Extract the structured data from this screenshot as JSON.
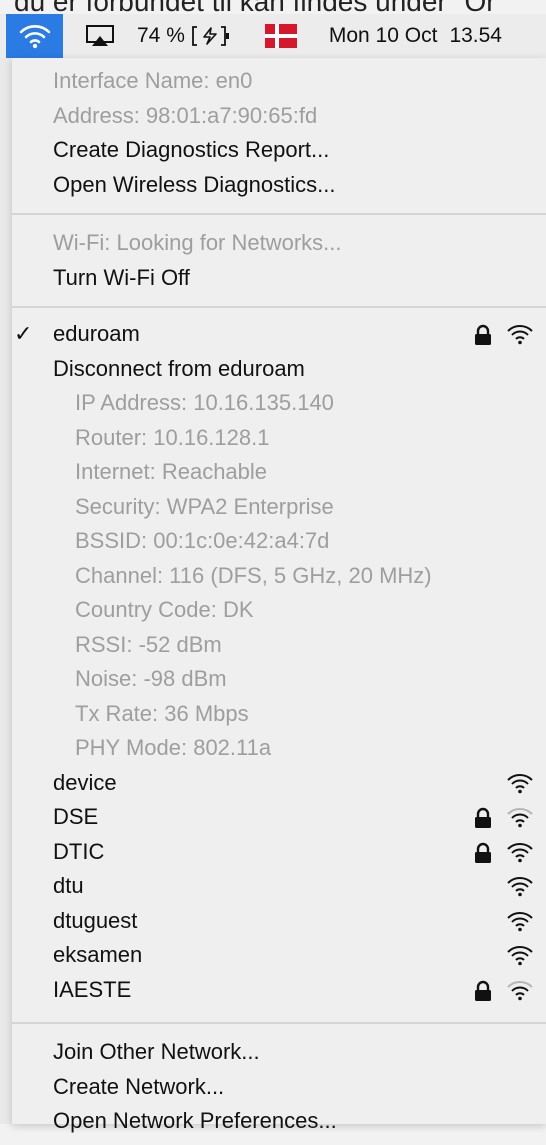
{
  "background_text": "du er forbundet til kan findes under \"Or",
  "menubar": {
    "wifi_icon": "wifi-icon",
    "airplay_icon": "airplay-icon",
    "battery_percent": "74 %",
    "battery_icon": "battery-charging-icon",
    "flag_icon": "danish-flag-icon",
    "clock": "Mon 10 Oct",
    "time": "13.54",
    "accent": "#2a7be4"
  },
  "interface": {
    "name": "Interface Name: en0",
    "address": "Address: 98:01:a7:90:65:fd",
    "diagnostics_report": "Create Diagnostics Report...",
    "wireless_diagnostics": "Open Wireless Diagnostics..."
  },
  "wifi_status": {
    "status": "Wi-Fi: Looking for Networks...",
    "toggle": "Turn Wi-Fi Off"
  },
  "connected": {
    "checkmark": "✓",
    "name": "eduroam",
    "disconnect": "Disconnect from eduroam",
    "details": [
      "IP Address: 10.16.135.140",
      "Router: 10.16.128.1",
      "Internet: Reachable",
      "Security: WPA2 Enterprise",
      "BSSID: 00:1c:0e:42:a4:7d",
      "Channel: 116 (DFS, 5 GHz, 20 MHz)",
      "Country Code: DK",
      "RSSI: -52 dBm",
      "Noise: -98 dBm",
      "Tx Rate: 36 Mbps",
      "PHY Mode: 802.11a"
    ]
  },
  "networks": [
    {
      "name": "device",
      "locked": false,
      "signal": "full"
    },
    {
      "name": "DSE",
      "locked": true,
      "signal": "weak"
    },
    {
      "name": "DTIC",
      "locked": true,
      "signal": "full"
    },
    {
      "name": "dtu",
      "locked": false,
      "signal": "full"
    },
    {
      "name": "dtuguest",
      "locked": false,
      "signal": "full"
    },
    {
      "name": "eksamen",
      "locked": false,
      "signal": "full"
    },
    {
      "name": "IAESTE",
      "locked": true,
      "signal": "weak"
    }
  ],
  "actions": {
    "join_other": "Join Other Network...",
    "create_network": "Create Network...",
    "open_prefs": "Open Network Preferences..."
  }
}
